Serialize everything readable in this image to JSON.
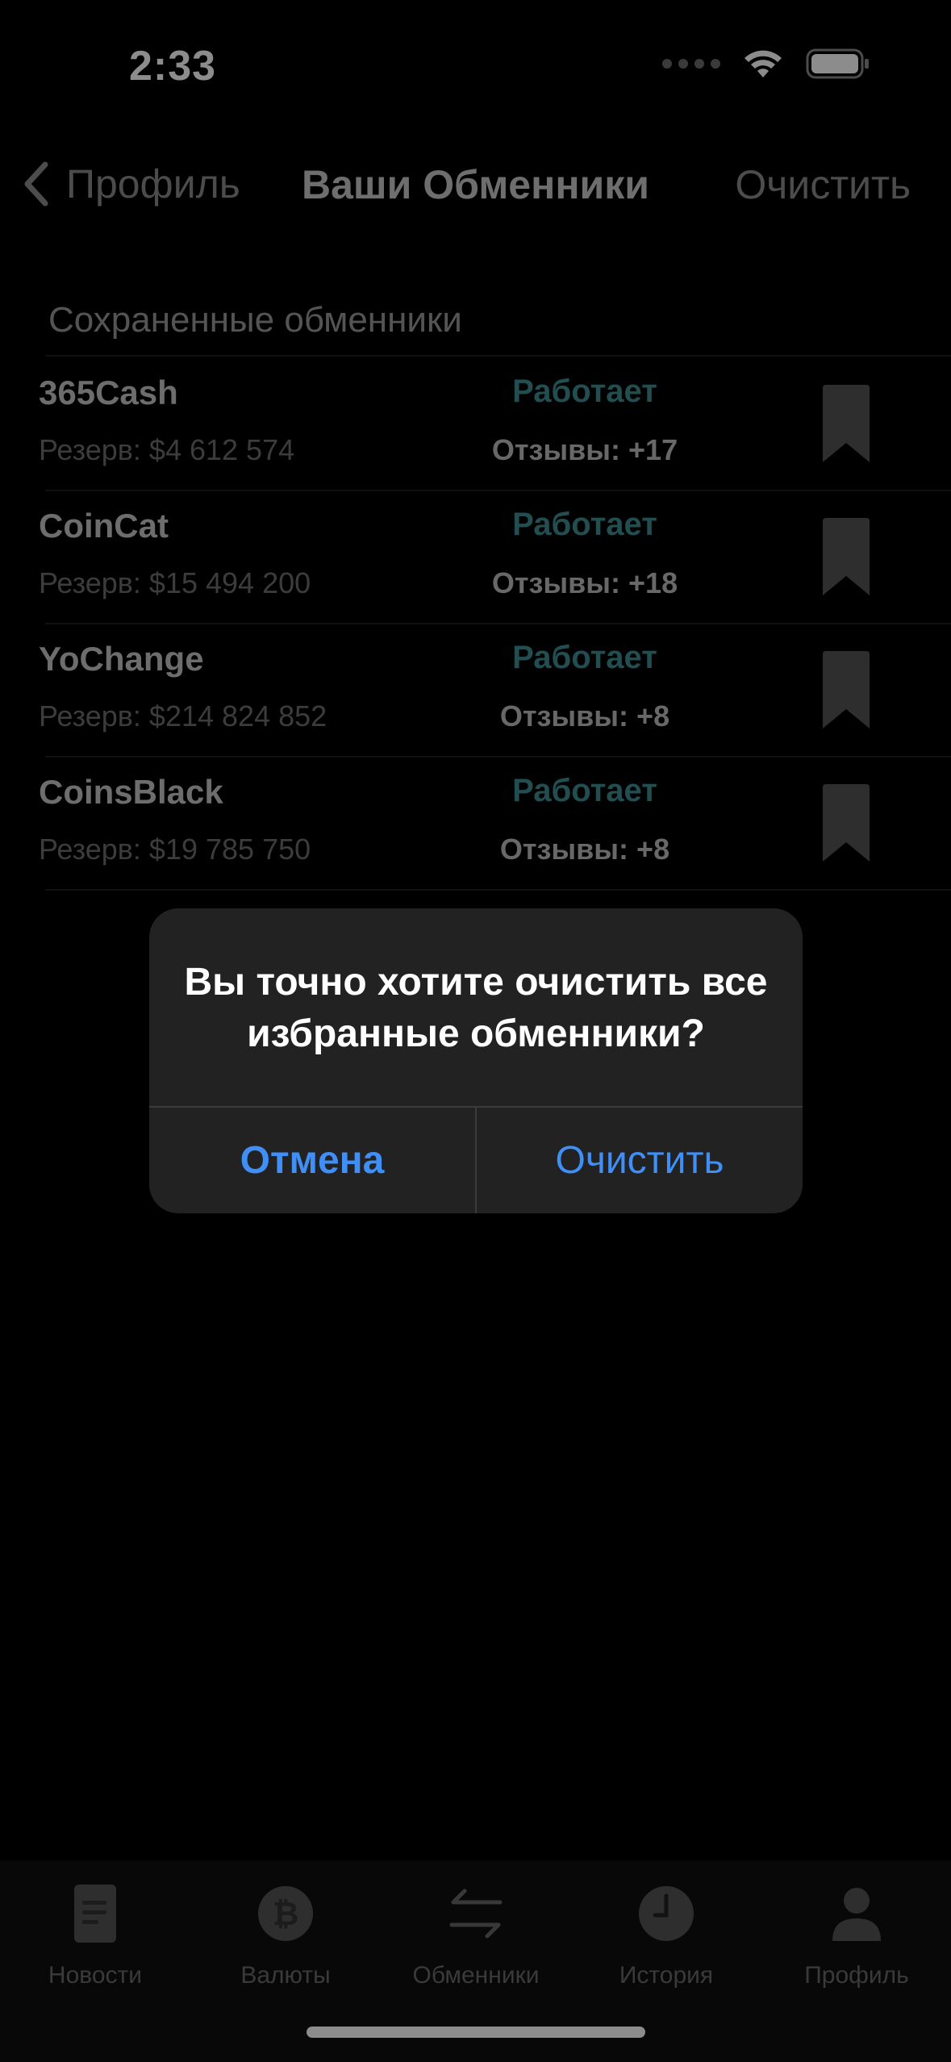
{
  "status_bar": {
    "time": "2:33"
  },
  "nav": {
    "back_label": "Профиль",
    "title": "Ваши Обменники",
    "action_label": "Очистить"
  },
  "section": {
    "header": "Сохраненные обменники"
  },
  "exchangers": [
    {
      "name": "365Cash",
      "reserve": "Резерв: $4 612 574",
      "status": "Работает",
      "reviews": "Отзывы: +17"
    },
    {
      "name": "CoinCat",
      "reserve": "Резерв: $15 494 200",
      "status": "Работает",
      "reviews": "Отзывы: +18"
    },
    {
      "name": "YoChange",
      "reserve": "Резерв: $214 824 852",
      "status": "Работает",
      "reviews": "Отзывы: +8"
    },
    {
      "name": "CoinsBlack",
      "reserve": "Резерв: $19 785 750",
      "status": "Работает",
      "reviews": "Отзывы: +8"
    }
  ],
  "alert": {
    "message": "Вы точно хотите очистить все избранные обменники?",
    "cancel_label": "Отмена",
    "confirm_label": "Очистить"
  },
  "tabs": [
    {
      "label": "Новости",
      "icon": "news-icon"
    },
    {
      "label": "Валюты",
      "icon": "bitcoin-icon"
    },
    {
      "label": "Обменники",
      "icon": "exchange-arrows-icon"
    },
    {
      "label": "История",
      "icon": "clock-icon"
    },
    {
      "label": "Профиль",
      "icon": "person-icon"
    }
  ],
  "colors": {
    "background": "#000000",
    "status_ok": "#3f8f94",
    "alert_accent": "#3f8ff7",
    "alert_bg": "#222222"
  }
}
